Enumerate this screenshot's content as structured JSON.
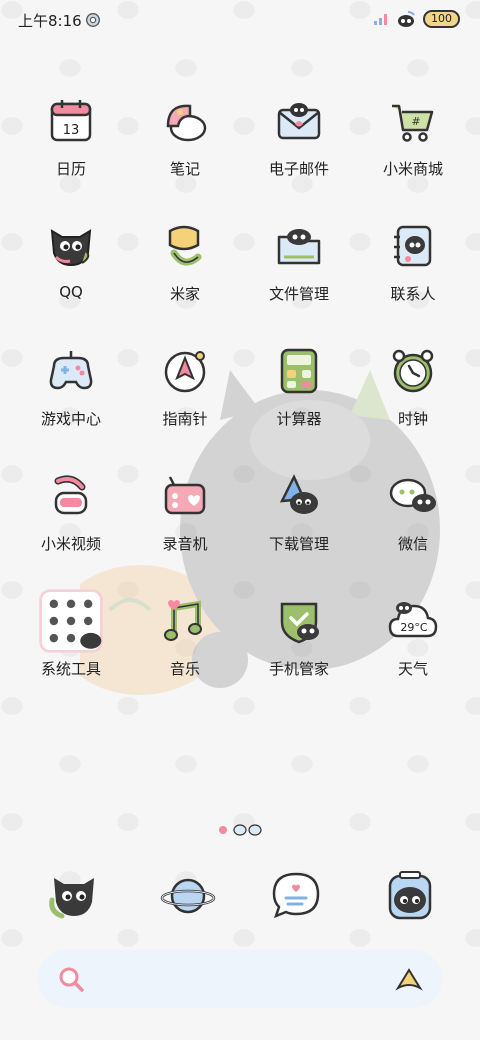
{
  "status_bar": {
    "time": "上午8:16",
    "battery": "100"
  },
  "apps": [
    {
      "label": "日历",
      "icon": "calendar-icon",
      "date": "13"
    },
    {
      "label": "笔记",
      "icon": "notes-icon"
    },
    {
      "label": "电子邮件",
      "icon": "email-icon"
    },
    {
      "label": "小米商城",
      "icon": "shopping-cart-icon"
    },
    {
      "label": "QQ",
      "icon": "qq-cat-icon"
    },
    {
      "label": "米家",
      "icon": "mijia-icon"
    },
    {
      "label": "文件管理",
      "icon": "file-manager-icon"
    },
    {
      "label": "联系人",
      "icon": "contacts-icon"
    },
    {
      "label": "游戏中心",
      "icon": "gamepad-icon"
    },
    {
      "label": "指南针",
      "icon": "compass-icon"
    },
    {
      "label": "计算器",
      "icon": "calculator-icon"
    },
    {
      "label": "时钟",
      "icon": "alarm-clock-icon"
    },
    {
      "label": "小米视频",
      "icon": "video-icon"
    },
    {
      "label": "录音机",
      "icon": "recorder-icon"
    },
    {
      "label": "下载管理",
      "icon": "download-icon"
    },
    {
      "label": "微信",
      "icon": "wechat-icon"
    },
    {
      "label": "系统工具",
      "icon": "system-tools-folder-icon"
    },
    {
      "label": "音乐",
      "icon": "music-icon"
    },
    {
      "label": "手机管家",
      "icon": "security-icon"
    },
    {
      "label": "天气",
      "icon": "weather-icon",
      "temp": "29°C"
    }
  ],
  "dock": [
    {
      "icon": "phone-cat-icon"
    },
    {
      "icon": "browser-planet-icon"
    },
    {
      "icon": "messages-icon"
    },
    {
      "icon": "camera-cat-icon"
    }
  ],
  "colors": {
    "background": "#f6f6f6",
    "search_bar": "#eef4fb",
    "accent_pink": "#f28aa0",
    "accent_green": "#8fae6b"
  }
}
